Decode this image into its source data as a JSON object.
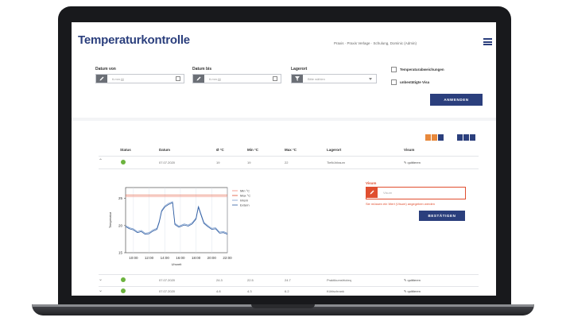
{
  "app": {
    "title": "Temperaturkontrolle",
    "header_user": "Praxis · Praxis Verlage · Schulung, Dominic (Admin)",
    "menu_icon": "hamburger-icon"
  },
  "filters": {
    "date_from": {
      "label": "Datum von",
      "placeholder": "tt.mm.jjjj",
      "icon": "calendar-icon"
    },
    "date_to": {
      "label": "Datum bis",
      "placeholder": "tt.mm.jjjj",
      "icon": "calendar-icon"
    },
    "storage": {
      "label": "Lagerort",
      "value": "Bitte wählen"
    },
    "checkbox_deviations": "Temperaturabweichungen",
    "checkbox_visa": "unbestätigte Visa",
    "apply_button": "ANWENDEN"
  },
  "table": {
    "columns": [
      "Status",
      "Datum",
      "Ø °C",
      "Min °C",
      "Max °C",
      "Lagerort",
      "Visum"
    ],
    "rows": [
      {
        "expanded": true,
        "status": "ok",
        "date": "07.07.2020",
        "avg": "19",
        "min": "19",
        "max": "22",
        "storage": "Tiefkühlraum",
        "visum": "quittieren"
      },
      {
        "expanded": false,
        "status": "ok",
        "date": "07.07.2020",
        "avg": "24.3",
        "min": "22.5",
        "max": "24.7",
        "storage": "Praktikumsfrioteq",
        "visum": "quittieren"
      },
      {
        "expanded": false,
        "status": "ok",
        "date": "07.07.2020",
        "avg": "4.8",
        "min": "4.3",
        "max": "6.2",
        "storage": "Kühlschrank",
        "visum": "quittieren"
      }
    ]
  },
  "chart_data": {
    "type": "line",
    "title": "",
    "xlabel": "Uhrzeit",
    "ylabel": "Temperatur",
    "xlim": [
      9,
      22
    ],
    "ylim": [
      15,
      27
    ],
    "x_ticks": [
      "10:00",
      "12:00",
      "14:00",
      "16:00",
      "18:00",
      "20:00",
      "22:00"
    ],
    "y_ticks": [
      15,
      20,
      25
    ],
    "grid": true,
    "legend_position": "top-right",
    "series": [
      {
        "name": "Min °C",
        "color": "#f08a7b",
        "values": [
          [
            9,
            25.3
          ],
          [
            22,
            25.3
          ]
        ]
      },
      {
        "name": "Max °C",
        "color": "#e04e2f",
        "values": [
          [
            9,
            25.6
          ],
          [
            22,
            25.6
          ]
        ]
      },
      {
        "name": "Intern",
        "color": "#7a9ccc",
        "values": [
          [
            9,
            20.0
          ],
          [
            9.5,
            19.6
          ],
          [
            10,
            19.4
          ],
          [
            10.5,
            18.9
          ],
          [
            11,
            19.1
          ],
          [
            11.5,
            18.6
          ],
          [
            12,
            18.7
          ],
          [
            12.5,
            19.2
          ],
          [
            13,
            19.5
          ],
          [
            13.3,
            20.8
          ],
          [
            13.6,
            22.8
          ],
          [
            14,
            23.6
          ],
          [
            14.5,
            24.1
          ],
          [
            15,
            24.4
          ],
          [
            15.3,
            20.4
          ],
          [
            15.8,
            19.9
          ],
          [
            16.5,
            20.3
          ],
          [
            17,
            20.1
          ],
          [
            17.5,
            20.5
          ],
          [
            18,
            21.4
          ],
          [
            18.3,
            23.6
          ],
          [
            18.6,
            22.3
          ],
          [
            19,
            20.6
          ],
          [
            19.5,
            20.0
          ],
          [
            20,
            19.5
          ],
          [
            20.5,
            19.6
          ],
          [
            21,
            18.8
          ],
          [
            21.5,
            18.9
          ],
          [
            22,
            18.6
          ]
        ]
      },
      {
        "name": "Extern",
        "color": "#2c5aa0",
        "values": [
          [
            9,
            19.8
          ],
          [
            9.5,
            19.4
          ],
          [
            10,
            19.2
          ],
          [
            10.5,
            18.7
          ],
          [
            11,
            18.9
          ],
          [
            11.5,
            18.4
          ],
          [
            12,
            18.5
          ],
          [
            12.5,
            19.0
          ],
          [
            13,
            19.3
          ],
          [
            13.3,
            20.6
          ],
          [
            13.6,
            22.6
          ],
          [
            14,
            23.4
          ],
          [
            14.5,
            23.9
          ],
          [
            15,
            24.2
          ],
          [
            15.3,
            20.2
          ],
          [
            15.8,
            19.7
          ],
          [
            16.5,
            20.1
          ],
          [
            17,
            19.9
          ],
          [
            17.5,
            20.3
          ],
          [
            18,
            21.2
          ],
          [
            18.3,
            23.4
          ],
          [
            18.6,
            22.1
          ],
          [
            19,
            20.4
          ],
          [
            19.5,
            19.8
          ],
          [
            20,
            19.3
          ],
          [
            20.5,
            19.4
          ],
          [
            21,
            18.6
          ],
          [
            21.5,
            18.7
          ],
          [
            22,
            18.4
          ]
        ]
      }
    ]
  },
  "comment": {
    "label": "Visum",
    "placeholder": "Visum",
    "error": "Sie müssen ein Wert (Visum) angegeben werden",
    "submit_button": "BESTÄTIGEN"
  },
  "colors": {
    "primary": "#2b3f7d",
    "accent": "#e04e2f",
    "success": "#6cb33e"
  }
}
